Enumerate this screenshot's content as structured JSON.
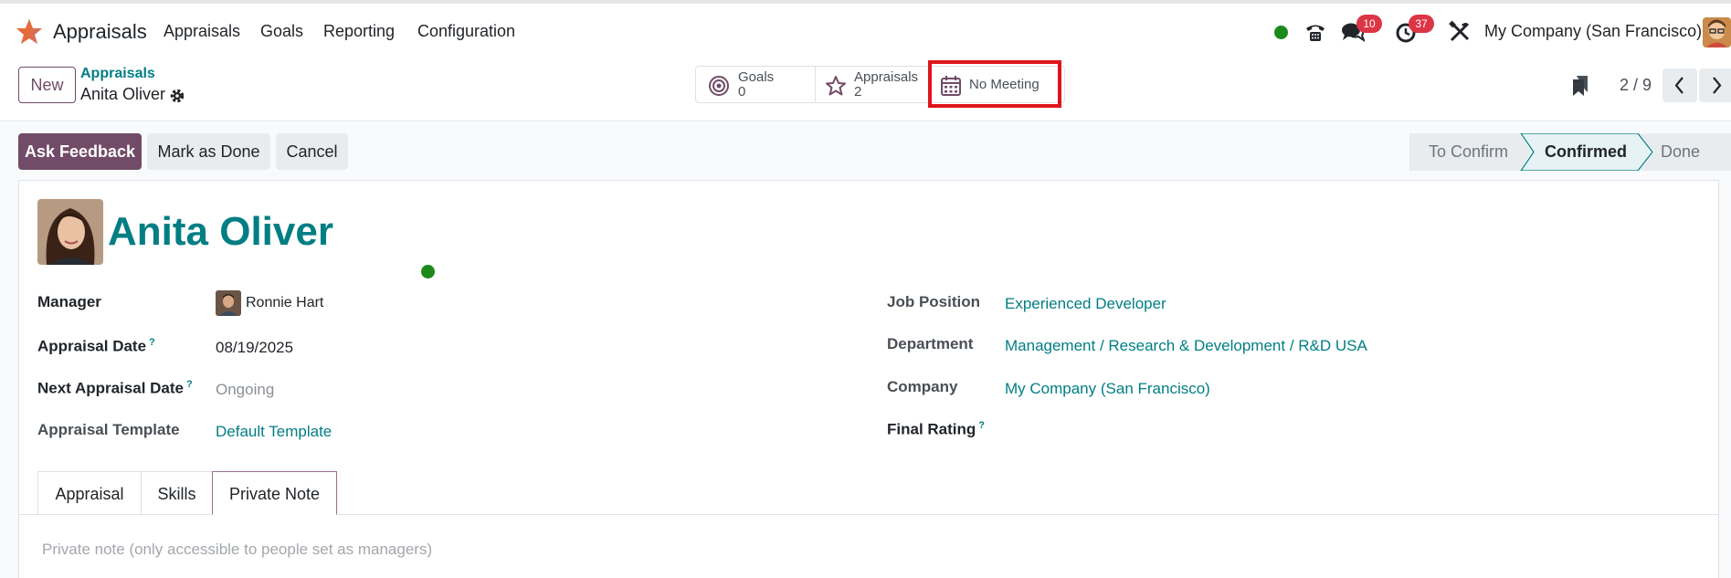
{
  "navbar": {
    "app_name": "Appraisals",
    "menu": [
      "Appraisals",
      "Goals",
      "Reporting",
      "Configuration"
    ],
    "chat_badge": "10",
    "activity_badge": "37",
    "company": "My Company (San Francisco)"
  },
  "control_panel": {
    "new_button": "New",
    "breadcrumb_parent": "Appraisals",
    "breadcrumb_current": "Anita Oliver",
    "smart_buttons": {
      "goals_label": "Goals",
      "goals_value": "0",
      "appraisals_label": "Appraisals",
      "appraisals_value": "2",
      "meeting_label": "No Meeting"
    },
    "pager": "2 / 9"
  },
  "statusbar": {
    "ask_feedback": "Ask Feedback",
    "mark_done": "Mark as Done",
    "cancel": "Cancel",
    "stages": [
      "To Confirm",
      "Confirmed",
      "Done"
    ],
    "active_stage": "Confirmed"
  },
  "form": {
    "employee_name": "Anita Oliver",
    "fields_left": {
      "manager_label": "Manager",
      "manager_value": "Ronnie Hart",
      "appraisal_date_label": "Appraisal Date",
      "appraisal_date_value": "08/19/2025",
      "next_date_label": "Next Appraisal Date",
      "next_date_value": "Ongoing",
      "template_label": "Appraisal Template",
      "template_value": "Default Template"
    },
    "fields_right": {
      "job_label": "Job Position",
      "job_value": "Experienced Developer",
      "department_label": "Department",
      "department_value": "Management / Research & Development / R&D USA",
      "company_label": "Company",
      "company_value": "My Company (San Francisco)",
      "rating_label": "Final Rating"
    },
    "help_mark": "?",
    "tabs": [
      "Appraisal",
      "Skills",
      "Private Note"
    ],
    "active_tab": "Private Note",
    "private_note_placeholder": "Private note (only accessible to people set as managers)"
  },
  "colors": {
    "brand": "#714b67",
    "link": "#017e84",
    "badge": "#dc3545",
    "online": "#1b8a1b",
    "highlight": "#e0131b"
  }
}
